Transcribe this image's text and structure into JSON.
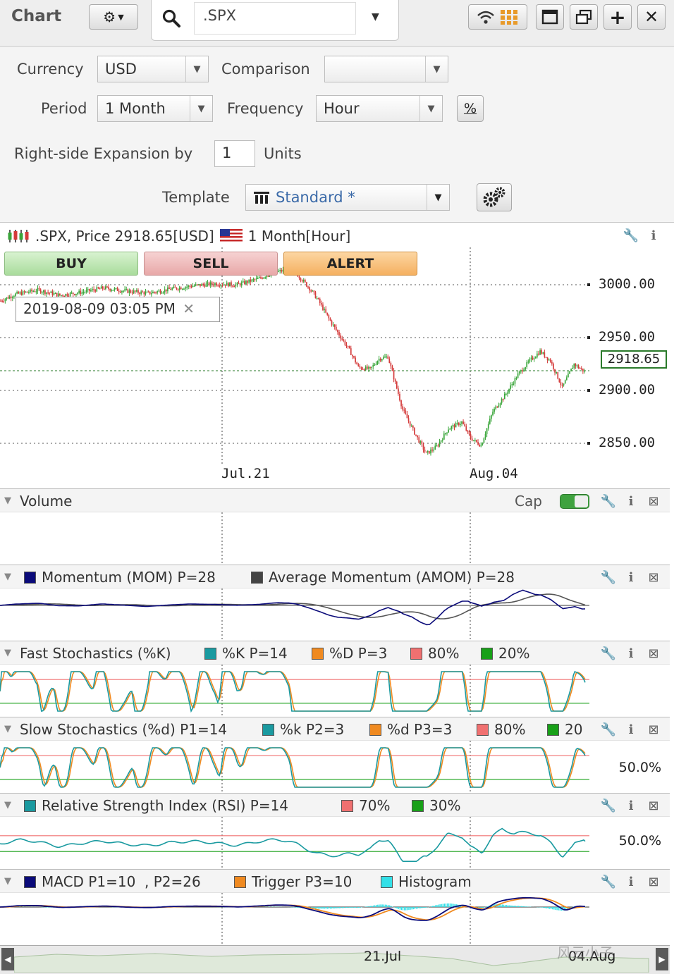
{
  "window": {
    "title": "Chart",
    "symbol": ".SPX",
    "settings_icon": "gear-dropdown-icon",
    "search_icon": "search-icon",
    "toolbar_icons": [
      "signal-grid-icon",
      "window-icon",
      "popout-icon",
      "add-icon",
      "close-icon"
    ]
  },
  "settings": {
    "currency_label": "Currency",
    "currency_value": "USD",
    "comparison_label": "Comparison",
    "comparison_value": "",
    "period_label": "Period",
    "period_value": "1 Month",
    "frequency_label": "Frequency",
    "frequency_value": "Hour",
    "percent_label": "%",
    "expansion_label": "Right-side Expansion by",
    "expansion_value": "1",
    "units_label": "Units",
    "template_label": "Template",
    "template_value": "Standard *"
  },
  "price_chart": {
    "header": ".SPX, Price 2918.65[USD]",
    "period_text": "1 Month[Hour]",
    "buy_label": "BUY",
    "sell_label": "SELL",
    "alert_label": "ALERT",
    "crosshair_time": "2019-08-09 03:05 PM",
    "last_price": "2918.65",
    "x_labels": [
      "Jul.21",
      "Aug.04"
    ],
    "colors": {
      "up": "#3aa63a",
      "down": "#d43a3a",
      "last_price_border": "#2a7a2a"
    }
  },
  "chart_data": {
    "type": "candlestick",
    "ylim": [
      2822,
      3022
    ],
    "y_ticks": [
      3000,
      2950,
      2900,
      2850
    ],
    "tick_labels": [
      "3000.00",
      "2950.00",
      "2900.00",
      "2850.00"
    ],
    "x_labels": [
      "Jul.21",
      "Aug.04"
    ],
    "approx_close_path": [
      [
        0,
        2985
      ],
      [
        10,
        2991
      ],
      [
        25,
        2995
      ],
      [
        40,
        2990
      ],
      [
        55,
        2993
      ],
      [
        70,
        2997
      ],
      [
        85,
        2994
      ],
      [
        100,
        2992
      ],
      [
        115,
        2996
      ],
      [
        130,
        2999
      ],
      [
        145,
        3001
      ],
      [
        160,
        3000
      ],
      [
        175,
        3006
      ],
      [
        185,
        3012
      ],
      [
        195,
        3014
      ],
      [
        200,
        3011
      ],
      [
        210,
        2995
      ],
      [
        215,
        2985
      ],
      [
        222,
        2968
      ],
      [
        228,
        2955
      ],
      [
        236,
        2938
      ],
      [
        242,
        2922
      ],
      [
        250,
        2920
      ],
      [
        256,
        2930
      ],
      [
        262,
        2932
      ],
      [
        272,
        2882
      ],
      [
        280,
        2860
      ],
      [
        288,
        2840
      ],
      [
        295,
        2847
      ],
      [
        303,
        2864
      ],
      [
        312,
        2870
      ],
      [
        318,
        2855
      ],
      [
        325,
        2848
      ],
      [
        333,
        2880
      ],
      [
        342,
        2897
      ],
      [
        350,
        2915
      ],
      [
        358,
        2928
      ],
      [
        365,
        2937
      ],
      [
        372,
        2928
      ],
      [
        380,
        2903
      ],
      [
        388,
        2925
      ],
      [
        395,
        2918
      ]
    ],
    "last": 2918.65
  },
  "volume": {
    "title": "Volume",
    "cap_label": "Cap"
  },
  "momentum": {
    "legend": [
      {
        "label": "Momentum (MOM) P=28",
        "color": "#0b0b7a"
      },
      {
        "label": "Average Momentum (AMOM) P=28",
        "color": "#444444"
      }
    ]
  },
  "fast_stoch": {
    "title": "Fast Stochastics (%K)",
    "legend": [
      {
        "label": "%K P=14",
        "color": "#1a9aa0"
      },
      {
        "label": "%D P=3",
        "color": "#f08a20"
      },
      {
        "label": "80%",
        "color": "#f07070"
      },
      {
        "label": "20%",
        "color": "#18a018"
      }
    ]
  },
  "slow_stoch": {
    "title": "Slow Stochastics (%d) P1=14",
    "legend": [
      {
        "label": "%k P2=3",
        "color": "#1a9aa0"
      },
      {
        "label": "%d P3=3",
        "color": "#f08a20"
      },
      {
        "label": "80%",
        "color": "#f07070"
      },
      {
        "label": "20",
        "color": "#18a018"
      }
    ],
    "scale_label": "50.0%"
  },
  "rsi": {
    "title": "Relative Strength Index (RSI) P=14",
    "legend": [
      {
        "label": "70%",
        "color": "#f07070"
      },
      {
        "label": "30%",
        "color": "#18a018"
      }
    ],
    "scale_label": "50.0%"
  },
  "macd": {
    "legend": [
      {
        "label": "MACD P1=10  , P2=26",
        "color": "#0b0b7a"
      },
      {
        "label": "Trigger P3=10",
        "color": "#f08a20"
      },
      {
        "label": "Histogram",
        "color": "#33e0e8"
      }
    ]
  },
  "navigator": {
    "labels": [
      "21.Jul",
      "04.Aug"
    ],
    "watermark": "风云小子"
  }
}
